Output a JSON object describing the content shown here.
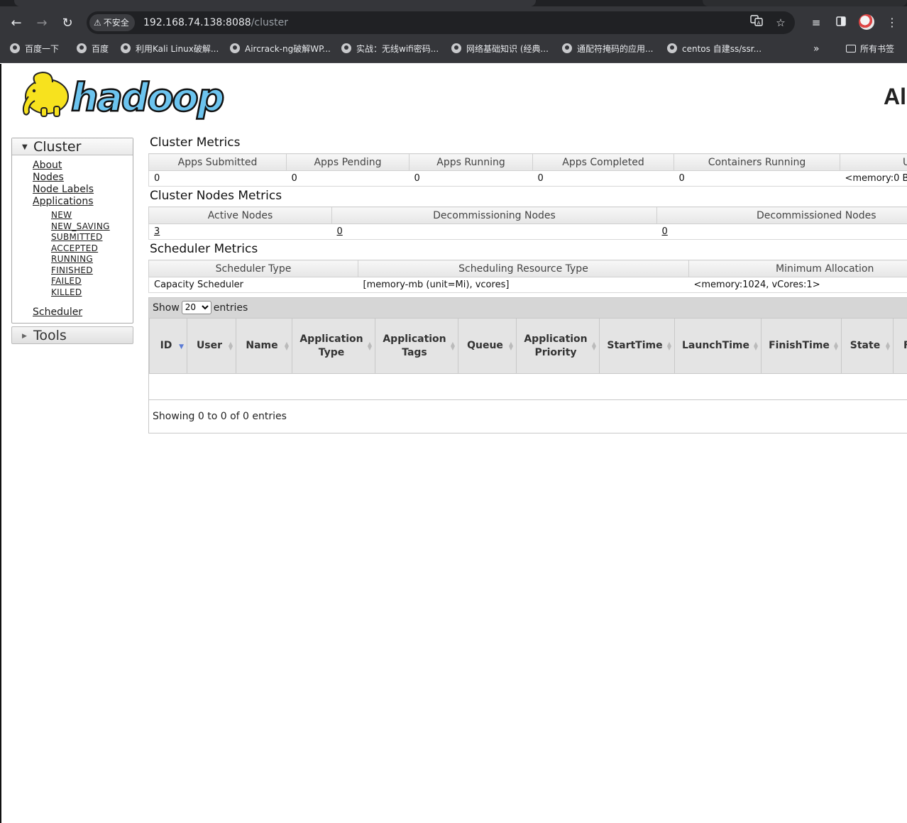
{
  "browser": {
    "security_label": "不安全",
    "url_host": "192.168.74.138:8088",
    "url_path": "/cluster",
    "bookmarks": [
      "百度一下",
      "百度",
      "利用Kali Linux破解...",
      "Aircrack-ng破解WP...",
      "实战：无线wifi密码...",
      "网络基础知识 (经典...",
      "通配符掩码的应用...",
      "centos 自建ss/ssr..."
    ],
    "bookmarks_more": "»",
    "bookmarks_folder": "所有书签"
  },
  "header": {
    "title": "Al"
  },
  "sidebar": {
    "cluster_label": "Cluster",
    "items": [
      "About",
      "Nodes",
      "Node Labels",
      "Applications"
    ],
    "app_states": [
      "NEW",
      "NEW_SAVING",
      "SUBMITTED",
      "ACCEPTED",
      "RUNNING",
      "FINISHED",
      "FAILED",
      "KILLED"
    ],
    "scheduler_label": "Scheduler",
    "tools_label": "Tools"
  },
  "cluster_metrics": {
    "title": "Cluster Metrics",
    "headers": [
      "Apps Submitted",
      "Apps Pending",
      "Apps Running",
      "Apps Completed",
      "Containers Running",
      "U"
    ],
    "values": [
      "0",
      "0",
      "0",
      "0",
      "0",
      "<memory:0 B"
    ]
  },
  "nodes_metrics": {
    "title": "Cluster Nodes Metrics",
    "headers": [
      "Active Nodes",
      "Decommissioning Nodes",
      "Decommissioned Nodes"
    ],
    "values": [
      "3",
      "0",
      "0"
    ]
  },
  "scheduler_metrics": {
    "title": "Scheduler Metrics",
    "headers": [
      "Scheduler Type",
      "Scheduling Resource Type",
      "Minimum Allocation"
    ],
    "values": [
      "Capacity Scheduler",
      "[memory-mb (unit=Mi), vcores]",
      "<memory:1024, vCores:1>"
    ]
  },
  "apps_table": {
    "show_label": "Show",
    "entries_value": "20",
    "entries_label": "entries",
    "columns": [
      "ID",
      "User",
      "Name",
      "Application Type",
      "Application Tags",
      "Queue",
      "Application Priority",
      "StartTime",
      "LaunchTime",
      "FinishTime",
      "State",
      "F"
    ],
    "info": "Showing 0 to 0 of 0 entries"
  }
}
